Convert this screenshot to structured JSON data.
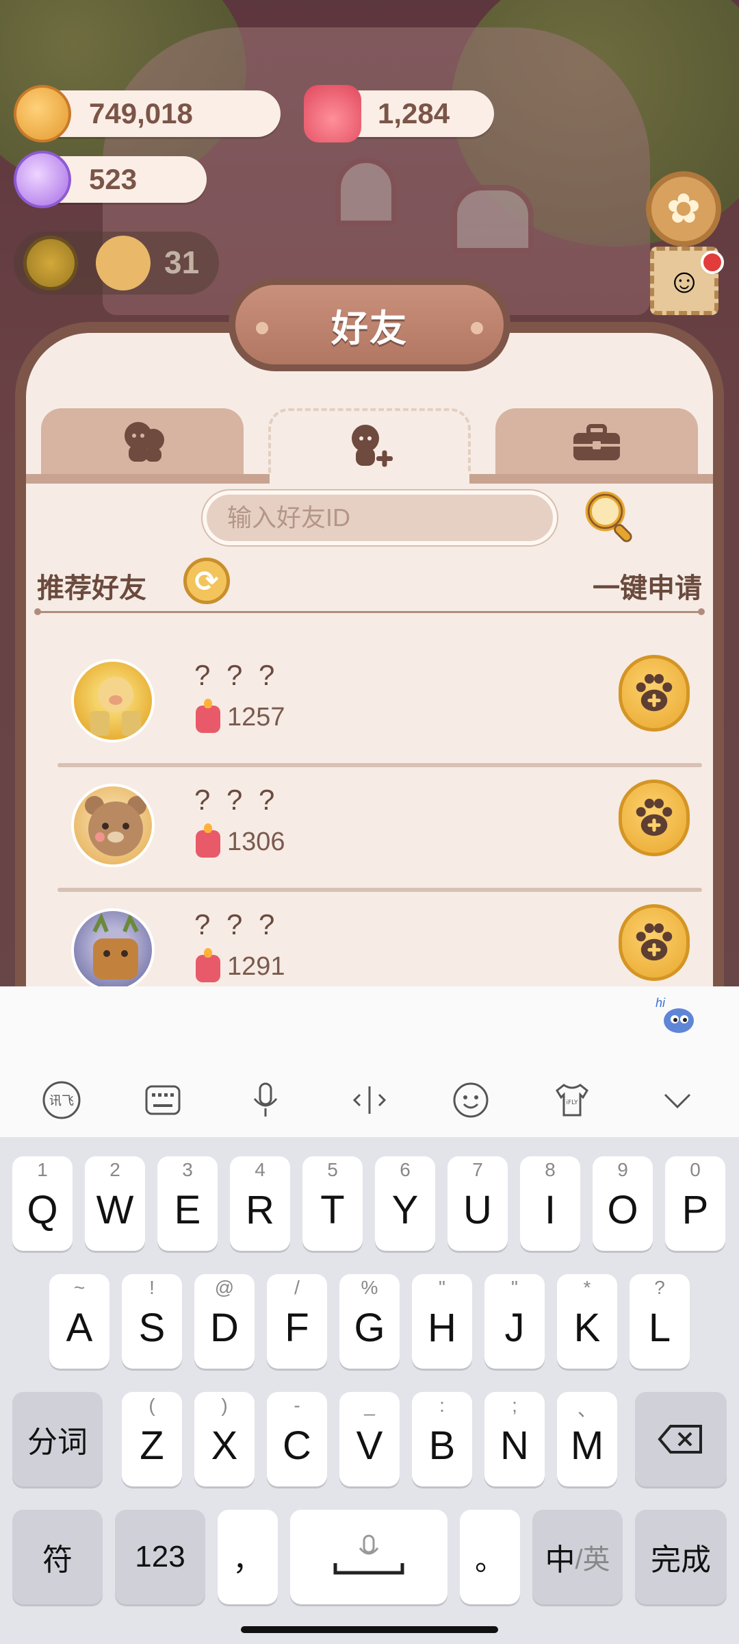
{
  "resources": {
    "cookies": "749,018",
    "candles": "1,284",
    "gems": "523",
    "level": "31"
  },
  "panel": {
    "title": "好友",
    "tabs": [
      {
        "icon": "friends-icon",
        "active": false
      },
      {
        "icon": "add-friend-icon",
        "active": true
      },
      {
        "icon": "briefcase-icon",
        "active": false
      }
    ],
    "search": {
      "placeholder": "输入好友ID",
      "value": ""
    },
    "recommended_label": "推荐好友",
    "apply_all_label": "一键申请",
    "friends": [
      {
        "name": "? ? ?",
        "score": "1257",
        "avatar": "pig-avatar"
      },
      {
        "name": "? ? ?",
        "score": "1306",
        "avatar": "bear-avatar"
      },
      {
        "name": "? ? ?",
        "score": "1291",
        "avatar": "deer-avatar"
      }
    ]
  },
  "keyboard": {
    "row1": [
      {
        "key": "Q",
        "num": "1"
      },
      {
        "key": "W",
        "num": "2"
      },
      {
        "key": "E",
        "num": "3"
      },
      {
        "key": "R",
        "num": "4"
      },
      {
        "key": "T",
        "num": "5"
      },
      {
        "key": "Y",
        "num": "6"
      },
      {
        "key": "U",
        "num": "7"
      },
      {
        "key": "I",
        "num": "8"
      },
      {
        "key": "O",
        "num": "9"
      },
      {
        "key": "P",
        "num": "0"
      }
    ],
    "row2": [
      {
        "key": "A",
        "num": "~"
      },
      {
        "key": "S",
        "num": "!"
      },
      {
        "key": "D",
        "num": "@"
      },
      {
        "key": "F",
        "num": "/"
      },
      {
        "key": "G",
        "num": "%"
      },
      {
        "key": "H",
        "num": "\""
      },
      {
        "key": "J",
        "num": "\""
      },
      {
        "key": "K",
        "num": "*"
      },
      {
        "key": "L",
        "num": "?"
      }
    ],
    "row3": [
      {
        "key": "Z",
        "num": "("
      },
      {
        "key": "X",
        "num": ")"
      },
      {
        "key": "C",
        "num": "-"
      },
      {
        "key": "V",
        "num": "_"
      },
      {
        "key": "B",
        "num": ":"
      },
      {
        "key": "N",
        "num": ";"
      },
      {
        "key": "M",
        "num": "、"
      }
    ],
    "segment_label": "分词",
    "symbol_label": "符",
    "num_label": "123",
    "comma": "，",
    "period": "。",
    "lang_primary": "中",
    "lang_secondary": "/英",
    "done_label": "完成",
    "hi_label": "hi"
  },
  "colors": {
    "panel_border": "#7d5649",
    "panel_bg": "#f6ece5",
    "accent_gold": "#f2c45b"
  }
}
